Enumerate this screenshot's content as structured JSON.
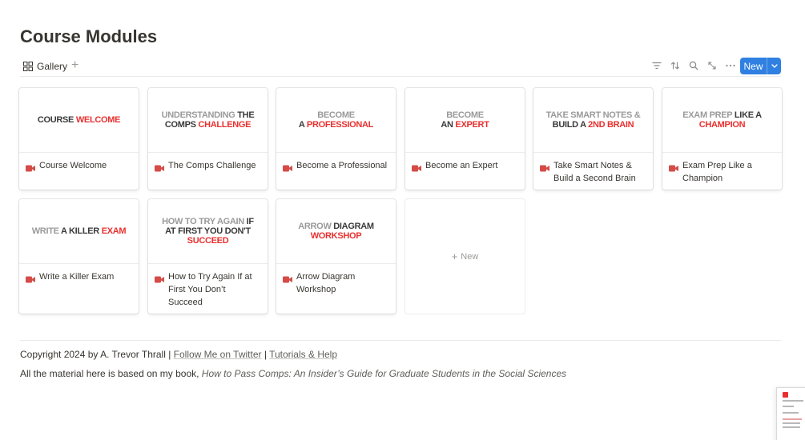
{
  "page": {
    "title": "Course Modules"
  },
  "toolbar": {
    "view_label": "Gallery",
    "add_view": "+",
    "new_label": "New",
    "icons": [
      "filter-icon",
      "sort-icon",
      "search-icon",
      "expand-icon",
      "more-icon"
    ]
  },
  "cards": [
    {
      "cover": [
        [
          "d",
          "COURSE "
        ],
        [
          "r",
          "WELCOME"
        ]
      ],
      "title": "Course Welcome"
    },
    {
      "cover": [
        [
          "g",
          "UNDERSTANDING "
        ],
        [
          "d",
          "THE"
        ],
        [
          "br",
          ""
        ],
        [
          "d",
          "COMPS "
        ],
        [
          "r",
          "CHALLENGE"
        ]
      ],
      "title": "The Comps Challenge"
    },
    {
      "cover": [
        [
          "g",
          "BECOME"
        ],
        [
          "br",
          ""
        ],
        [
          "d",
          "A "
        ],
        [
          "r",
          "PROFESSIONAL"
        ]
      ],
      "title": "Become a Professional"
    },
    {
      "cover": [
        [
          "g",
          "BECOME"
        ],
        [
          "br",
          ""
        ],
        [
          "d",
          "AN "
        ],
        [
          "r",
          "EXPERT"
        ]
      ],
      "title": "Become an Expert"
    },
    {
      "cover": [
        [
          "g",
          "TAKE SMART NOTES &"
        ],
        [
          "br",
          ""
        ],
        [
          "d",
          "BUILD A "
        ],
        [
          "r",
          "2ND BRAIN"
        ]
      ],
      "title": "Take Smart Notes & Build a Second Brain"
    },
    {
      "cover": [
        [
          "g",
          "EXAM PREP "
        ],
        [
          "d",
          "LIKE A "
        ],
        [
          "r",
          "CHAMPION"
        ]
      ],
      "title": "Exam Prep Like a Champion"
    },
    {
      "cover": [
        [
          "g",
          "WRITE "
        ],
        [
          "d",
          "A KILLER "
        ],
        [
          "r",
          "EXAM"
        ]
      ],
      "title": "Write a Killer Exam"
    },
    {
      "cover": [
        [
          "g",
          "HOW TO TRY AGAIN "
        ],
        [
          "d",
          "IF"
        ],
        [
          "br",
          ""
        ],
        [
          "d",
          "AT FIRST YOU DON'T "
        ],
        [
          "r",
          "SUCCEED"
        ]
      ],
      "title": "How to Try Again If at First You Don’t Succeed"
    },
    {
      "cover": [
        [
          "g",
          "ARROW "
        ],
        [
          "d",
          "DIAGRAM "
        ],
        [
          "r",
          "WORKSHOP"
        ]
      ],
      "title": "Arrow Diagram Workshop"
    }
  ],
  "new_card_label": "New",
  "footer": {
    "copyright": "Copyright 2024 by A. Trevor Thrall",
    "sep": " | ",
    "link_twitter": "Follow Me on Twitter",
    "link_tutorials": "Tutorials & Help",
    "line2_prefix": "All the material here is based on my book, ",
    "book_title": "How to Pass Comps: An Insider’s Guide for Graduate Students in the Social Sciences"
  },
  "colors": {
    "accent": "#2f80e1",
    "brand_red": "#e8302f",
    "video_icon": "#d44c47"
  }
}
